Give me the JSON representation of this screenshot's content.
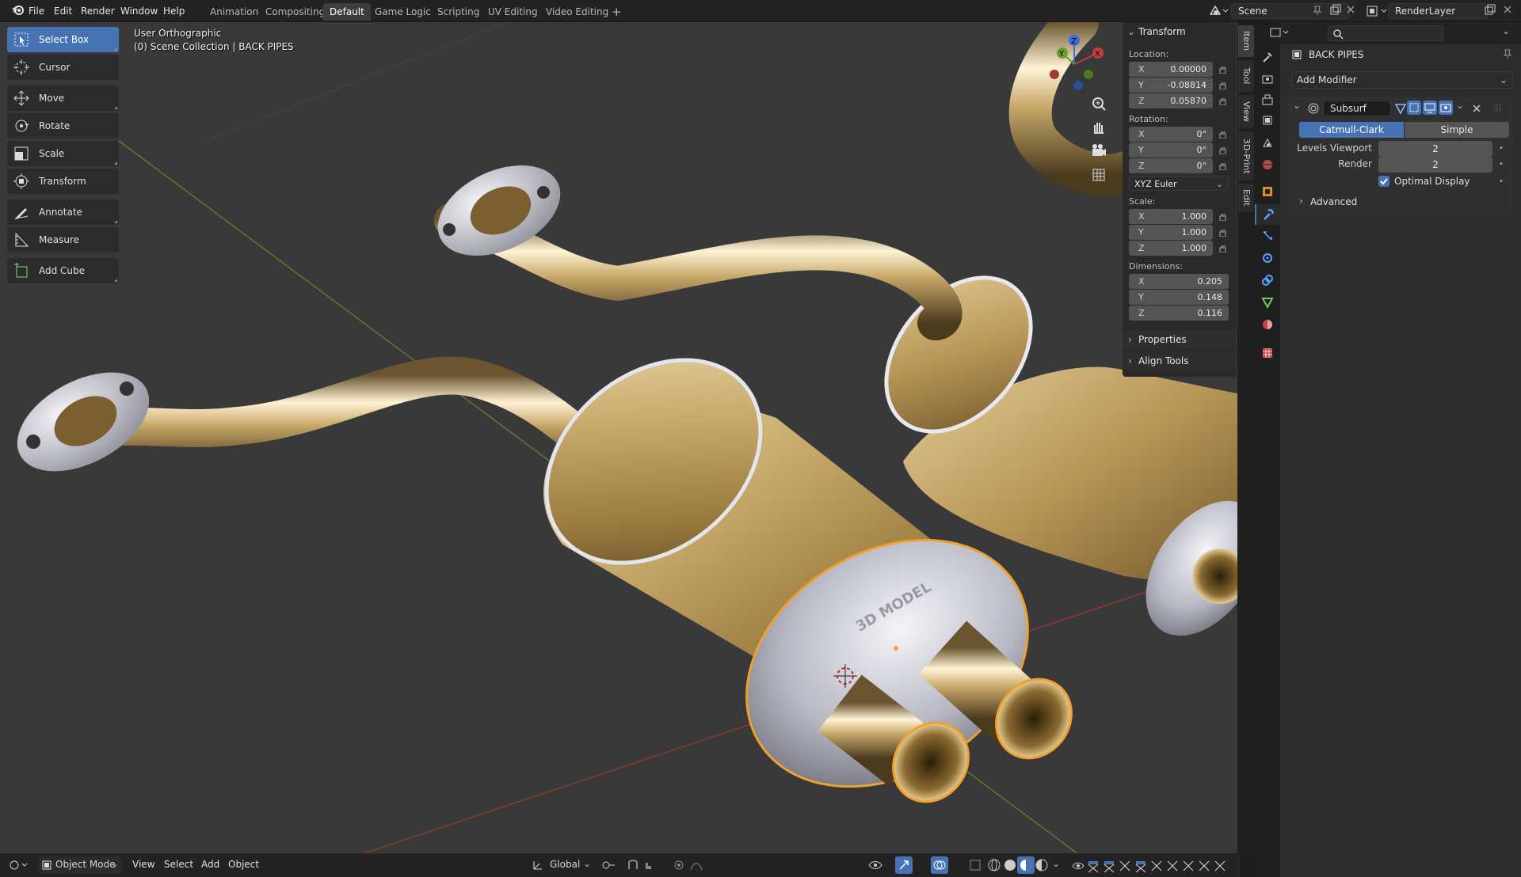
{
  "menu": {
    "items": [
      "File",
      "Edit",
      "Render",
      "Window",
      "Help"
    ]
  },
  "workspaces": {
    "tabs": [
      "Animation",
      "Compositing",
      "Default",
      "Game Logic",
      "Scripting",
      "UV Editing",
      "Video Editing"
    ],
    "active": "Default",
    "add": "+"
  },
  "scene": {
    "name": "Scene",
    "render_layer": "RenderLayer"
  },
  "toolbar": {
    "tools": [
      "Select Box",
      "Cursor",
      "Move",
      "Rotate",
      "Scale",
      "Transform",
      "Annotate",
      "Measure",
      "Add Cube"
    ]
  },
  "viewport": {
    "view_name": "User Orthographic",
    "collection": "(0) Scene Collection | BACK PIPES",
    "brand": "3D MODEL"
  },
  "npanel": {
    "transform_title": "Transform",
    "location_label": "Location:",
    "location": [
      {
        "axis": "X",
        "value": "0.00000"
      },
      {
        "axis": "Y",
        "value": "-0.08814"
      },
      {
        "axis": "Z",
        "value": "0.05870"
      }
    ],
    "rotation_label": "Rotation:",
    "rotation": [
      {
        "axis": "X",
        "value": "0°"
      },
      {
        "axis": "Y",
        "value": "0°"
      },
      {
        "axis": "Z",
        "value": "0°"
      }
    ],
    "rotation_mode": "XYZ Euler",
    "scale_label": "Scale:",
    "scale": [
      {
        "axis": "X",
        "value": "1.000"
      },
      {
        "axis": "Y",
        "value": "1.000"
      },
      {
        "axis": "Z",
        "value": "1.000"
      }
    ],
    "dimensions_label": "Dimensions:",
    "dimensions": [
      {
        "axis": "X",
        "value": "0.205"
      },
      {
        "axis": "Y",
        "value": "0.148"
      },
      {
        "axis": "Z",
        "value": "0.116"
      }
    ],
    "properties_title": "Properties",
    "align_tools_title": "Align Tools"
  },
  "sidebar_tabs": [
    "Item",
    "Tool",
    "View",
    "3D-Print",
    "Edit"
  ],
  "bottom": {
    "mode": "Object Mode",
    "menus": [
      "View",
      "Select",
      "Add",
      "Object"
    ],
    "orientation": "Global"
  },
  "properties": {
    "object_name": "BACK PIPES",
    "add_modifier": "Add Modifier",
    "modifier_name": "Subsurf",
    "algo_active": "Catmull-Clark",
    "algo_other": "Simple",
    "levels_viewport_label": "Levels Viewport",
    "levels_viewport": "2",
    "render_label": "Render",
    "render": "2",
    "optimal_display": "Optimal Display",
    "advanced": "Advanced"
  },
  "colors": {
    "accent": "#4772b3",
    "viewport_bg": "#393939",
    "panel_bg": "#2b2b2b",
    "selection_outline": "#f0a030",
    "gold": "#c9a96a"
  }
}
